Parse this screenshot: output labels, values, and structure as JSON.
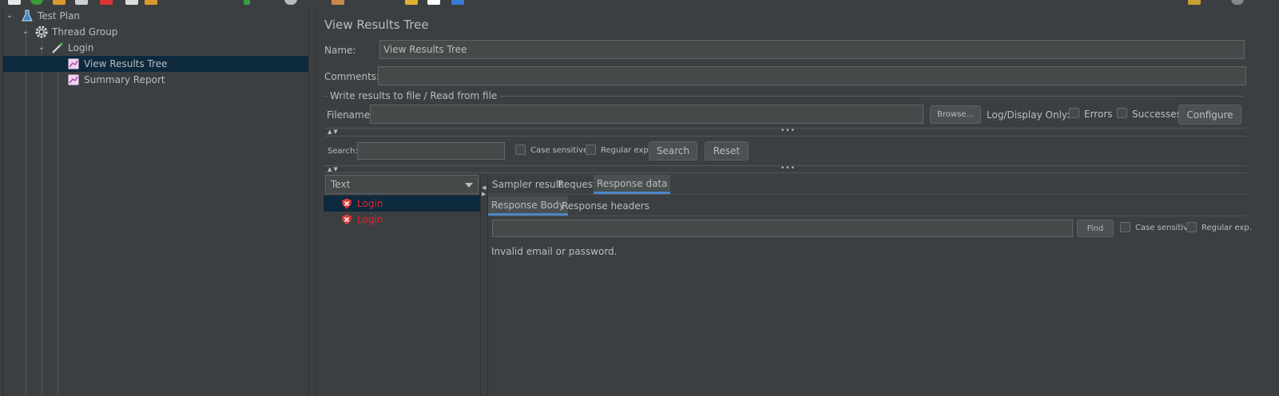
{
  "tree": {
    "items": [
      {
        "label": "Test Plan"
      },
      {
        "label": "Thread Group"
      },
      {
        "label": "Login"
      },
      {
        "label": "View Results Tree"
      },
      {
        "label": "Summary Report"
      }
    ]
  },
  "panel": {
    "title": "View Results Tree",
    "name_label": "Name:",
    "name_value": "View Results Tree",
    "comments_label": "Comments:",
    "comments_value": "",
    "group_label": "Write results to file / Read from file",
    "filename_label": "Filename",
    "filename_value": "",
    "browse_label": "Browse...",
    "log_display_label": "Log/Display Only:",
    "errors_label": "Errors",
    "successes_label": "Successes",
    "configure_label": "Configure"
  },
  "search": {
    "label": "Search:",
    "value": "",
    "case_sensitive_label": "Case sensitive",
    "regular_exp_label": "Regular exp.",
    "search_button": "Search",
    "reset_button": "Reset"
  },
  "results": {
    "renderer": "Text",
    "items": [
      {
        "label": "Login",
        "status": "error"
      },
      {
        "label": "Login",
        "status": "error"
      }
    ]
  },
  "tabs": {
    "main": [
      "Sampler result",
      "Request",
      "Response data"
    ],
    "active_main": "Response data",
    "sub": [
      "Response Body",
      "Response headers"
    ],
    "active_sub": "Response Body"
  },
  "find": {
    "value": "",
    "button": "Find",
    "case_sensitive_label": "Case sensitive",
    "regular_exp_label": "Regular exp."
  },
  "response_body": "Invalid email or password.",
  "colors": {
    "background": "#3c3f41",
    "selection": "#0d293e",
    "error_text": "#e0262a",
    "tab_accent": "#4a88c7"
  }
}
